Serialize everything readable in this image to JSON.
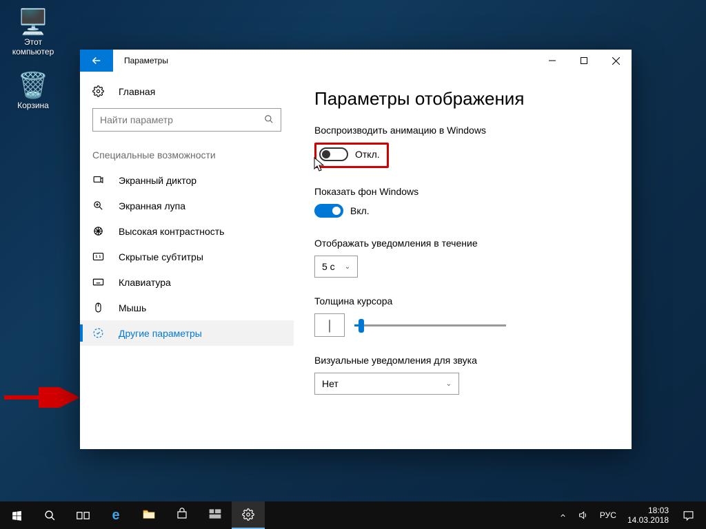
{
  "desktop": {
    "this_pc": "Этот компьютер",
    "recycle": "Корзина"
  },
  "window": {
    "title": "Параметры"
  },
  "sidebar": {
    "home": "Главная",
    "search_placeholder": "Найти параметр",
    "section": "Специальные возможности",
    "items": {
      "narrator": "Экранный диктор",
      "magnifier": "Экранная лупа",
      "contrast": "Высокая контрастность",
      "captions": "Скрытые субтитры",
      "keyboard": "Клавиатура",
      "mouse": "Мышь",
      "other": "Другие параметры"
    }
  },
  "content": {
    "page_title": "Параметры отображения",
    "animate_label": "Воспроизводить анимацию в Windows",
    "animate_state": "Откл.",
    "wallpaper_label": "Показать фон Windows",
    "wallpaper_state": "Вкл.",
    "notif_duration_label": "Отображать уведомления в течение",
    "notif_duration_value": "5 с",
    "cursor_label": "Толщина курсора",
    "visual_alert_label": "Визуальные уведомления для звука",
    "visual_alert_value": "Нет"
  },
  "taskbar": {
    "lang": "РУС",
    "time": "18:03",
    "date": "14.03.2018"
  }
}
